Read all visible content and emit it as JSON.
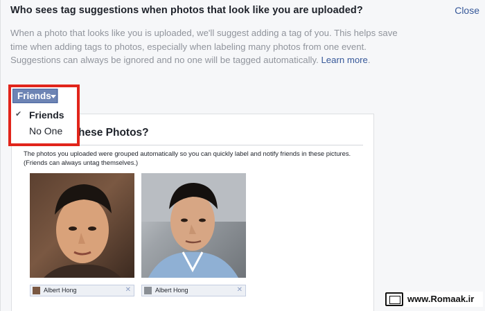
{
  "dialog": {
    "question": "Who sees tag suggestions when photos that look like you are uploaded?",
    "close_label": "Close",
    "description": "When a photo that looks like you is uploaded, we'll suggest adding a tag of you. This helps save time when adding tags to photos, especially when labeling many photos from one event. Suggestions can always be ignored and no one will be tagged automatically.",
    "learn_more": "Learn more"
  },
  "audience": {
    "selected": "Friends",
    "options": [
      {
        "label": "Friends",
        "checked": true
      },
      {
        "label": "No One",
        "checked": false
      }
    ],
    "highlight_color": "#e1251b",
    "button_color": "#6d84b4"
  },
  "preview": {
    "title_partial": "hese Photos?",
    "body": "The photos you uploaded were grouped automatically so you can quickly label and notify friends in these pictures. (Friends can always untag themselves.)",
    "tags": [
      {
        "name": "Albert Hong"
      },
      {
        "name": "Albert Hong"
      }
    ]
  },
  "watermark": {
    "text": "www.Romaak.ir"
  }
}
